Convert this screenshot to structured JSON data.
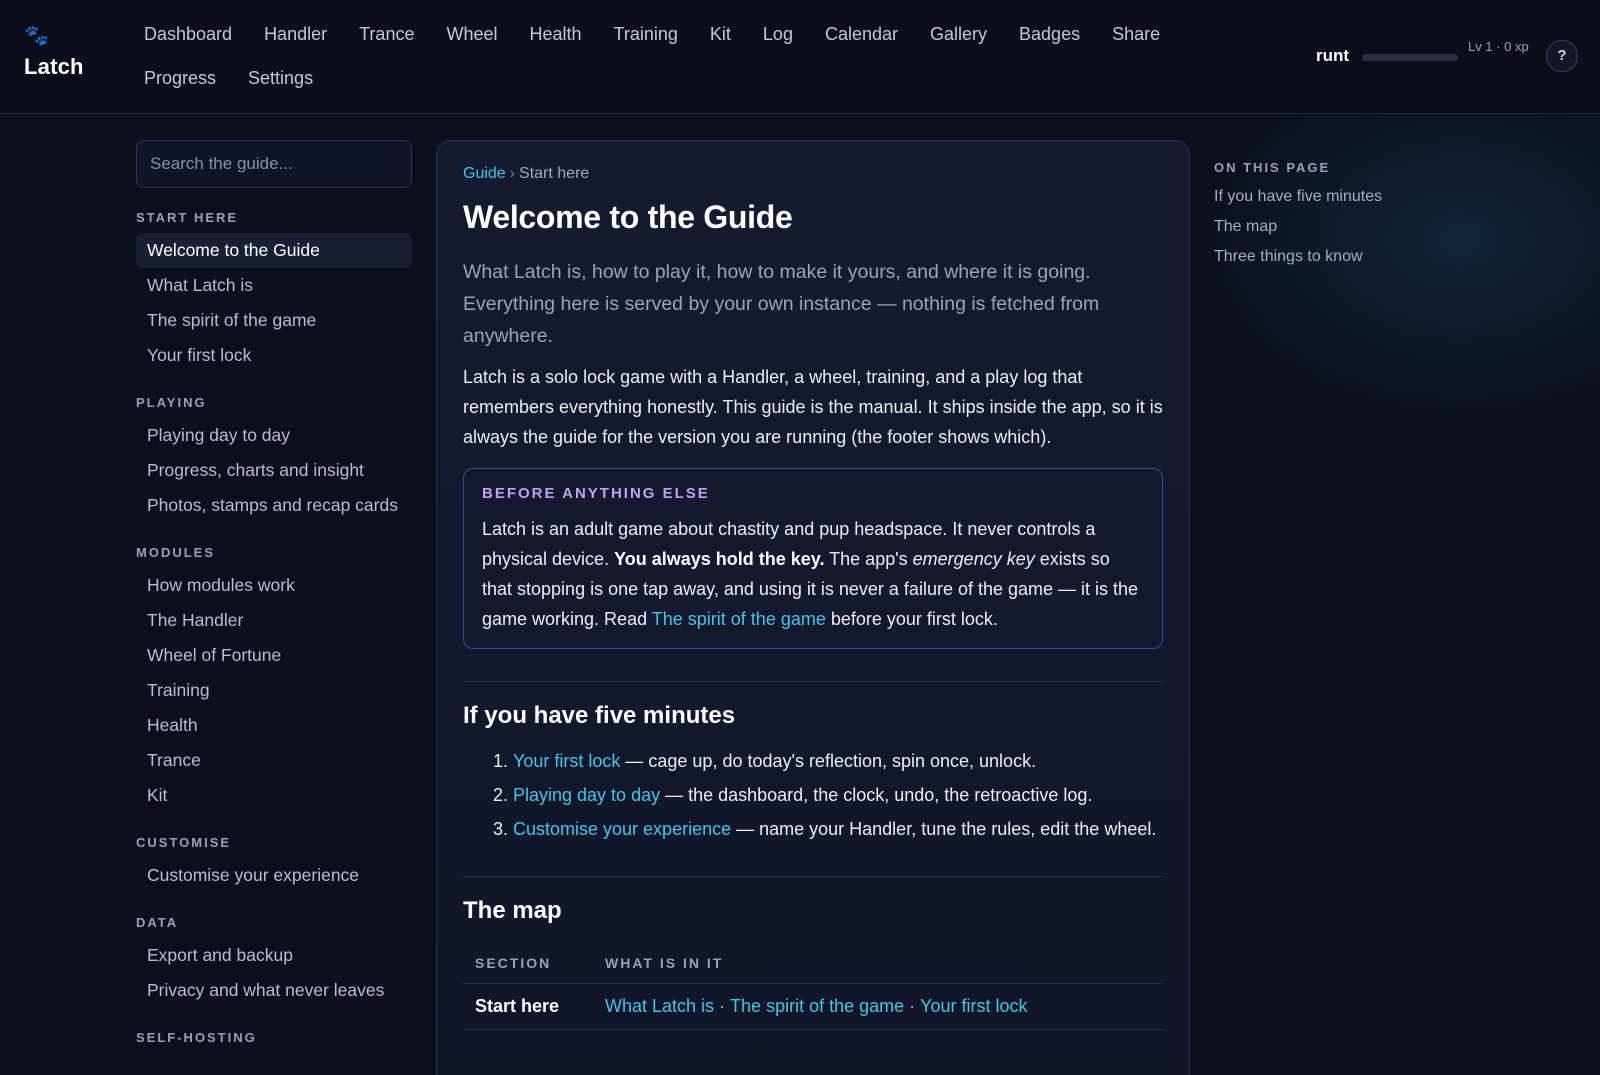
{
  "brand": {
    "icon": "paw-icon",
    "name": "Latch"
  },
  "nav": [
    "Dashboard",
    "Handler",
    "Trance",
    "Wheel",
    "Health",
    "Training",
    "Kit",
    "Log",
    "Calendar",
    "Gallery",
    "Badges",
    "Share",
    "Progress",
    "Settings"
  ],
  "user": {
    "name": "runt",
    "level_text": "Lv 1 · 0 xp",
    "xp_progress": 0.0
  },
  "help_label": "?",
  "search": {
    "placeholder": "Search the guide..."
  },
  "sidebar": [
    {
      "title": "START HERE",
      "items": [
        "Welcome to the Guide",
        "What Latch is",
        "The spirit of the game",
        "Your first lock"
      ]
    },
    {
      "title": "PLAYING",
      "items": [
        "Playing day to day",
        "Progress, charts and insight",
        "Photos, stamps and recap cards"
      ]
    },
    {
      "title": "MODULES",
      "items": [
        "How modules work",
        "The Handler",
        "Wheel of Fortune",
        "Training",
        "Health",
        "Trance",
        "Kit"
      ]
    },
    {
      "title": "CUSTOMISE",
      "items": [
        "Customise your experience"
      ]
    },
    {
      "title": "DATA",
      "items": [
        "Export and backup",
        "Privacy and what never leaves"
      ]
    },
    {
      "title": "SELF-HOSTING",
      "items": []
    }
  ],
  "active_item": "Welcome to the Guide",
  "breadcrumb": {
    "root": "Guide",
    "sep": "›",
    "current": "Start here"
  },
  "page": {
    "title": "Welcome to the Guide",
    "lede": "What Latch is, how to play it, how to make it yours, and where it is going. Everything here is served by your own instance — nothing is fetched from anywhere.",
    "intro": "Latch is a solo lock game with a Handler, a wheel, training, and a play log that remembers everything honestly. This guide is the manual. It ships inside the app, so it is always the guide for the version you are running (the footer shows which).",
    "callout": {
      "title": "BEFORE ANYTHING ELSE",
      "part1": "Latch is an adult game about chastity and pup headspace. It never controls a physical device. ",
      "bold": "You always hold the key.",
      "part2": " The app's ",
      "italic": "emergency key",
      "part3": " exists so that stopping is one tap away, and using it is never a failure of the game — it is the game working. Read ",
      "link": "The spirit of the game",
      "part4": " before your first lock."
    },
    "five_minutes": {
      "heading": "If you have five minutes",
      "steps": [
        {
          "link": "Your first lock",
          "text": " — cage up, do today's reflection, spin once, unlock."
        },
        {
          "link": "Playing day to day",
          "text": " — the dashboard, the clock, undo, the retroactive log."
        },
        {
          "link": "Customise your experience",
          "text": " — name your Handler, tune the rules, edit the wheel."
        }
      ]
    },
    "map": {
      "heading": "The map",
      "columns": [
        "SECTION",
        "WHAT IS IN IT"
      ],
      "rows": [
        {
          "section": "Start here",
          "links": [
            "What Latch is",
            "The spirit of the game",
            "Your first lock"
          ],
          "sep": "·"
        }
      ]
    }
  },
  "toc": {
    "title": "ON THIS PAGE",
    "items": [
      "If you have five minutes",
      "The map",
      "Three things to know"
    ]
  }
}
